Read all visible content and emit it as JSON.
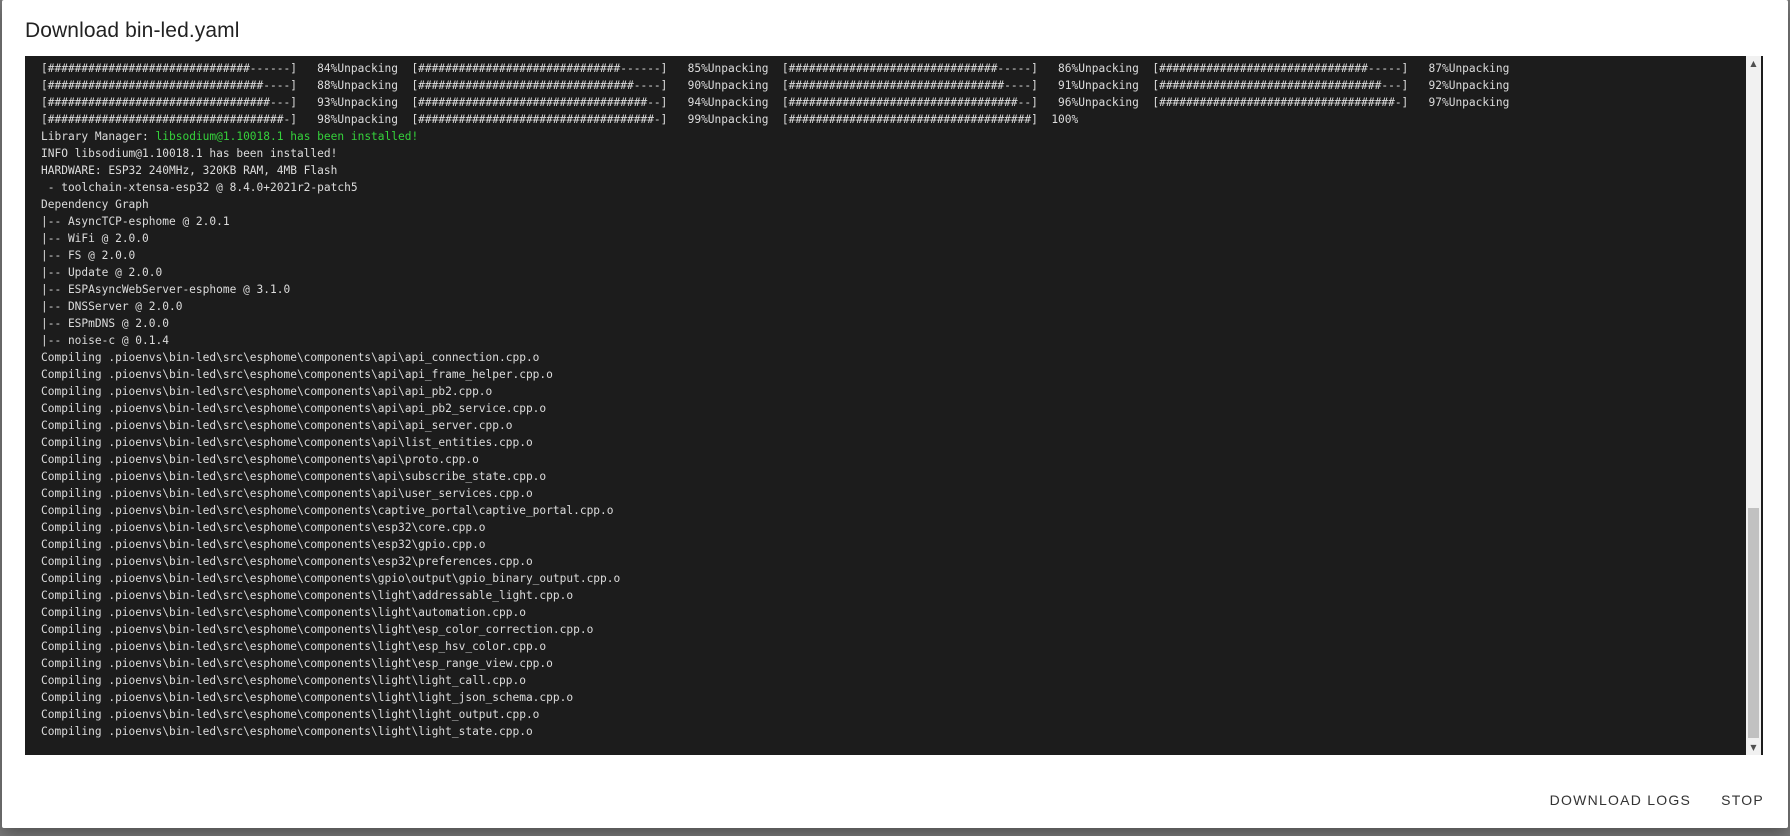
{
  "dialog": {
    "title": "Download bin-led.yaml"
  },
  "log": {
    "lines": [
      "[##############################------]   84%Unpacking  [##############################------]   85%Unpacking  [###############################-----]   86%Unpacking  [###############################-----]   87%Unpacking",
      "[################################----]   88%Unpacking  [################################----]   90%Unpacking  [################################----]   91%Unpacking  [#################################---]   92%Unpacking",
      "[#################################---]   93%Unpacking  [##################################--]   94%Unpacking  [##################################--]   96%Unpacking  [###################################-]   97%Unpacking",
      "[###################################-]   98%Unpacking  [###################################-]   99%Unpacking  [####################################]  100%",
      "Library Manager: ",
      "INFO libsodium@1.10018.1 has been installed!",
      "HARDWARE: ESP32 240MHz, 320KB RAM, 4MB Flash",
      " - toolchain-xtensa-esp32 @ 8.4.0+2021r2-patch5",
      "Dependency Graph",
      "|-- AsyncTCP-esphome @ 2.0.1",
      "|-- WiFi @ 2.0.0",
      "|-- FS @ 2.0.0",
      "|-- Update @ 2.0.0",
      "|-- ESPAsyncWebServer-esphome @ 3.1.0",
      "|-- DNSServer @ 2.0.0",
      "|-- ESPmDNS @ 2.0.0",
      "|-- noise-c @ 0.1.4",
      "Compiling .pioenvs\\bin-led\\src\\esphome\\components\\api\\api_connection.cpp.o",
      "Compiling .pioenvs\\bin-led\\src\\esphome\\components\\api\\api_frame_helper.cpp.o",
      "Compiling .pioenvs\\bin-led\\src\\esphome\\components\\api\\api_pb2.cpp.o",
      "Compiling .pioenvs\\bin-led\\src\\esphome\\components\\api\\api_pb2_service.cpp.o",
      "Compiling .pioenvs\\bin-led\\src\\esphome\\components\\api\\api_server.cpp.o",
      "Compiling .pioenvs\\bin-led\\src\\esphome\\components\\api\\list_entities.cpp.o",
      "Compiling .pioenvs\\bin-led\\src\\esphome\\components\\api\\proto.cpp.o",
      "Compiling .pioenvs\\bin-led\\src\\esphome\\components\\api\\subscribe_state.cpp.o",
      "Compiling .pioenvs\\bin-led\\src\\esphome\\components\\api\\user_services.cpp.o",
      "Compiling .pioenvs\\bin-led\\src\\esphome\\components\\captive_portal\\captive_portal.cpp.o",
      "Compiling .pioenvs\\bin-led\\src\\esphome\\components\\esp32\\core.cpp.o",
      "Compiling .pioenvs\\bin-led\\src\\esphome\\components\\esp32\\gpio.cpp.o",
      "Compiling .pioenvs\\bin-led\\src\\esphome\\components\\esp32\\preferences.cpp.o",
      "Compiling .pioenvs\\bin-led\\src\\esphome\\components\\gpio\\output\\gpio_binary_output.cpp.o",
      "Compiling .pioenvs\\bin-led\\src\\esphome\\components\\light\\addressable_light.cpp.o",
      "Compiling .pioenvs\\bin-led\\src\\esphome\\components\\light\\automation.cpp.o",
      "Compiling .pioenvs\\bin-led\\src\\esphome\\components\\light\\esp_color_correction.cpp.o",
      "Compiling .pioenvs\\bin-led\\src\\esphome\\components\\light\\esp_hsv_color.cpp.o",
      "Compiling .pioenvs\\bin-led\\src\\esphome\\components\\light\\esp_range_view.cpp.o",
      "Compiling .pioenvs\\bin-led\\src\\esphome\\components\\light\\light_call.cpp.o",
      "Compiling .pioenvs\\bin-led\\src\\esphome\\components\\light\\light_json_schema.cpp.o",
      "Compiling .pioenvs\\bin-led\\src\\esphome\\components\\light\\light_output.cpp.o",
      "Compiling .pioenvs\\bin-led\\src\\esphome\\components\\light\\light_state.cpp.o"
    ],
    "highlight": {
      "line_index": 4,
      "text": "libsodium@1.10018.1 has been installed!",
      "color": "#35d13b"
    }
  },
  "scrollbar": {
    "up_arrow_icon": "▲",
    "down_arrow_icon": "▼"
  },
  "actions": {
    "download_logs_label": "DOWNLOAD LOGS",
    "stop_label": "STOP"
  }
}
